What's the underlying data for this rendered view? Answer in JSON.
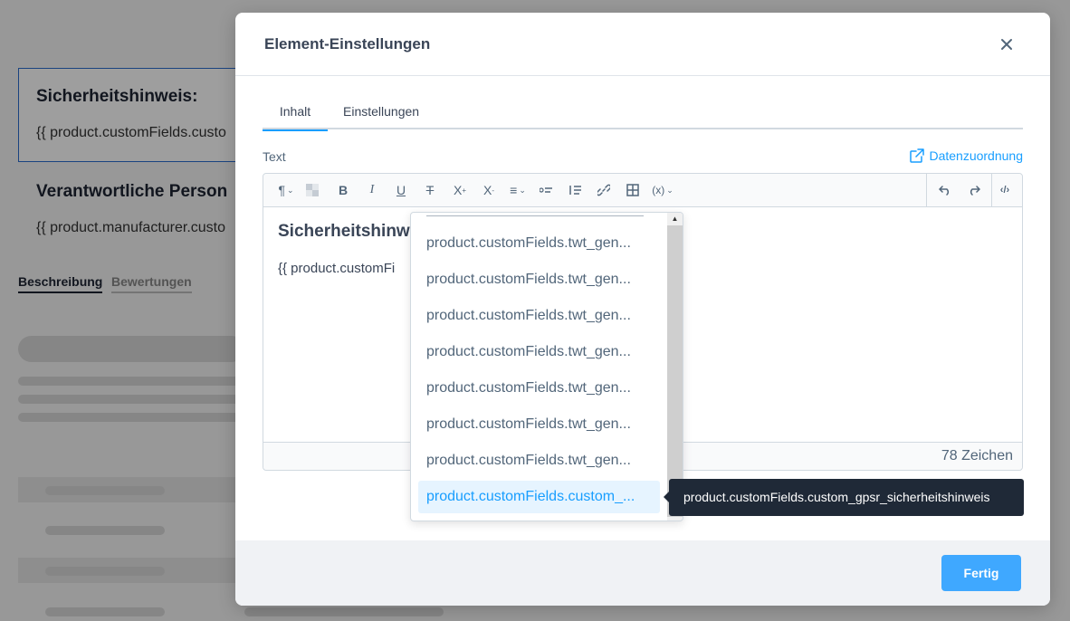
{
  "background": {
    "block1_title": "Sicherheitshinweis:",
    "block1_text": "{{ product.customFields.custo",
    "block2_title": "Verantwortliche Person",
    "block2_text": "{{ product.manufacturer.custo",
    "tab_description": "Beschreibung",
    "tab_reviews": "Bewertungen"
  },
  "modal": {
    "title": "Element-Einstellungen",
    "close_icon": "close-icon",
    "tabs": [
      {
        "label": "Inhalt",
        "active": true
      },
      {
        "label": "Einstellungen",
        "active": false
      }
    ],
    "field_label": "Text",
    "data_mapping_label": "Datenzuordnung",
    "editor": {
      "heading": "Sicherheitshinw",
      "paragraph": "{{ product.customFi",
      "char_count": "78 Zeichen"
    },
    "done_label": "Fertig"
  },
  "dropdown": {
    "items": [
      "product.customFields.twt_gen...",
      "product.customFields.twt_gen...",
      "product.customFields.twt_gen...",
      "product.customFields.twt_gen...",
      "product.customFields.twt_gen...",
      "product.customFields.twt_gen...",
      "product.customFields.twt_gen...",
      "product.customFields.custom_..."
    ],
    "selected_index": 7
  },
  "tooltip": "product.customFields.custom_gpsr_sicherheitshinweis",
  "colors": {
    "accent": "#189eff",
    "button": "#3fa8ff",
    "tooltip_bg": "#1f2937"
  }
}
